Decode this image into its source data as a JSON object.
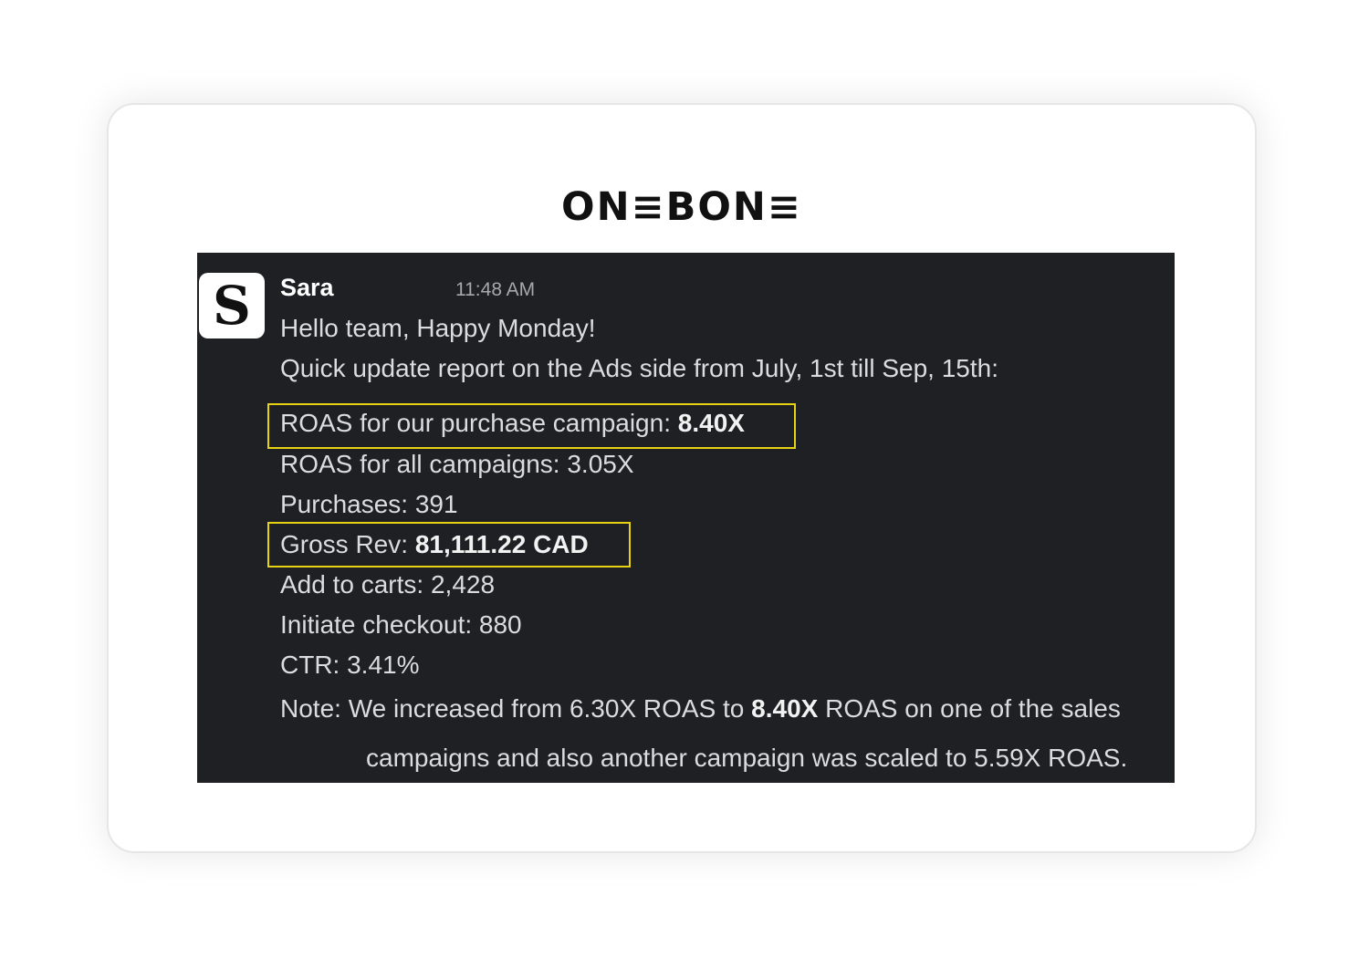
{
  "logo": {
    "text": "ON≡BON≡"
  },
  "message": {
    "author": "Sara",
    "time": "11:48 AM",
    "avatar_letter": "S",
    "greeting": "Hello team, Happy Monday!",
    "intro": "Quick update report on the Ads side from July, 1st till Sep, 15th:",
    "roas_purchase_label": "ROAS for our purchase campaign: ",
    "roas_purchase_value": "8.40X",
    "roas_all": "ROAS for all campaigns: 3.05X",
    "purchases": "Purchases: 391",
    "gross_rev_label": "Gross Rev: ",
    "gross_rev_value": "81,111.22 CAD",
    "add_to_carts": "Add to carts: 2,428",
    "initiate_checkout": "Initiate checkout: 880",
    "ctr": "CTR: 3.41%",
    "note_part1": "Note: We increased from 6.30X ROAS to ",
    "note_bold": "8.40X",
    "note_part2": " ROAS on one of the sales",
    "note_line2": "campaigns and also another campaign was scaled to 5.59X ROAS."
  },
  "colors": {
    "highlight_border": "#e8d312",
    "chat_background": "#1f2024"
  }
}
